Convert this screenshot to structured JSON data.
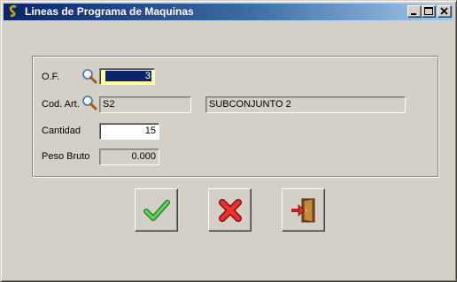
{
  "window": {
    "title": "Lineas de Programa de Maquinas"
  },
  "form": {
    "of": {
      "label": "O.F.",
      "value": "3"
    },
    "cod_art": {
      "label": "Cod. Art.",
      "code": "S2",
      "description": "SUBCONJUNTO 2"
    },
    "cantidad": {
      "label": "Cantidad",
      "value": "15"
    },
    "peso_bruto": {
      "label": "Peso Bruto",
      "value": "0.000"
    }
  },
  "icons": {
    "app": "app-s-icon",
    "lookup": "magnifier-icon",
    "ok": "green-check-icon",
    "cancel": "red-x-icon",
    "exit": "exit-door-icon"
  },
  "colors": {
    "titlebar_start": "#0a246a",
    "titlebar_end": "#a6caf0",
    "window_bg": "#d4d0c8",
    "highlight_field": "#ffff99",
    "check": "#2e9e2e",
    "cross": "#d42020"
  }
}
